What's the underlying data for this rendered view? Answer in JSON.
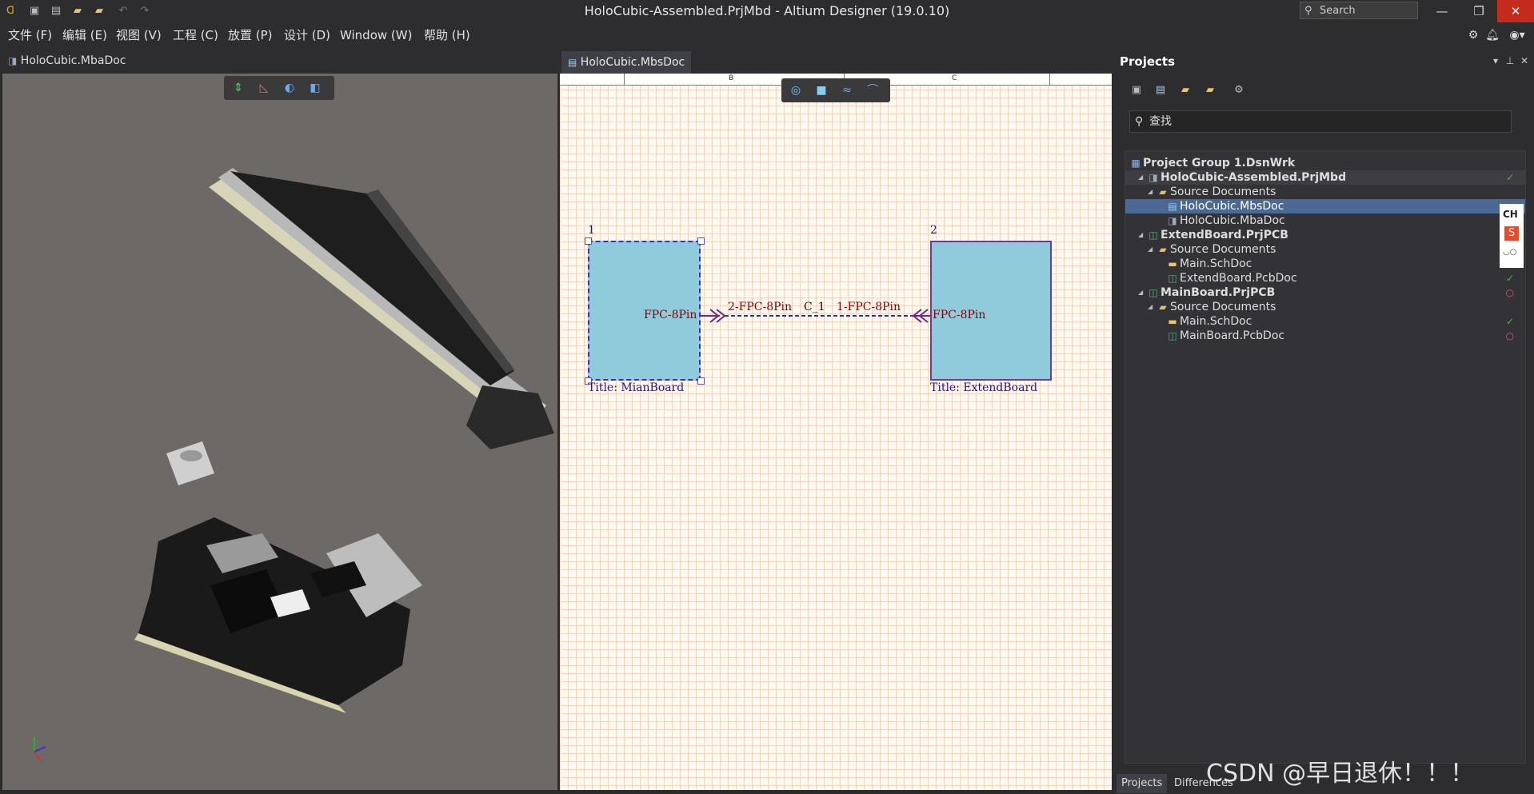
{
  "window": {
    "title": "HoloCubic-Assembled.PrjMbd - Altium Designer (19.0.10)",
    "search_placeholder": "Search"
  },
  "menu": [
    "文件 (F)",
    "编辑 (E)",
    "视图 (V)",
    "工程 (C)",
    "放置 (P)",
    "设计 (D)",
    "Window (W)",
    "帮助 (H)"
  ],
  "left_doc": {
    "tab": "HoloCubic.MbaDoc"
  },
  "mid_doc": {
    "tab": "HoloCubic.MbsDoc",
    "ruler": [
      "B",
      "C"
    ],
    "block1": {
      "num": "1",
      "port": "FPC-8Pin",
      "title": "Title: MianBoard"
    },
    "block2": {
      "num": "2",
      "port": "FPC-8Pin",
      "title": "Title: ExtendBoard"
    },
    "conn_left": "2-FPC-8Pin",
    "conn_mid": "C_1",
    "conn_right": "1-FPC-8Pin"
  },
  "projects": {
    "header": "Projects",
    "search_placeholder": "查找",
    "tree": [
      {
        "label": "Project Group 1.DsnWrk",
        "level": 0,
        "icon": "project-group-icon",
        "bold": true
      },
      {
        "label": "HoloCubic-Assembled.PrjMbd",
        "level": 1,
        "icon": "multiboard-project-icon",
        "bold": true,
        "status": "ok",
        "expanded": true
      },
      {
        "label": "Source Documents",
        "level": 2,
        "icon": "folder-icon",
        "expanded": true
      },
      {
        "label": "HoloCubic.MbsDoc",
        "level": 3,
        "icon": "mbs-doc-icon",
        "selected": true
      },
      {
        "label": "HoloCubic.MbaDoc",
        "level": 3,
        "icon": "mba-doc-icon"
      },
      {
        "label": "ExtendBoard.PrjPCB",
        "level": 1,
        "icon": "pcb-project-icon",
        "bold": true,
        "expanded": true
      },
      {
        "label": "Source Documents",
        "level": 2,
        "icon": "folder-icon",
        "expanded": true
      },
      {
        "label": "Main.SchDoc",
        "level": 3,
        "icon": "sch-doc-icon",
        "status": "ok"
      },
      {
        "label": "ExtendBoard.PcbDoc",
        "level": 3,
        "icon": "pcb-doc-icon",
        "status": "ok"
      },
      {
        "label": "MainBoard.PrjPCB",
        "level": 1,
        "icon": "pcb-project-icon",
        "bold": true,
        "status": "modified",
        "expanded": true
      },
      {
        "label": "Source Documents",
        "level": 2,
        "icon": "folder-icon",
        "expanded": true
      },
      {
        "label": "Main.SchDoc",
        "level": 3,
        "icon": "sch-doc-icon",
        "status": "ok"
      },
      {
        "label": "MainBoard.PcbDoc",
        "level": 3,
        "icon": "pcb-doc-icon",
        "status": "modified"
      }
    ],
    "bottom_tabs": [
      "Projects",
      "Differences"
    ]
  },
  "ime": {
    "label": "CH"
  },
  "watermark": "CSDN @早日退休！！！",
  "colors": {
    "ok": "#3fbf3f",
    "modified": "#e05a5a",
    "selection": "#4a6a93",
    "close": "#c42b1c"
  }
}
